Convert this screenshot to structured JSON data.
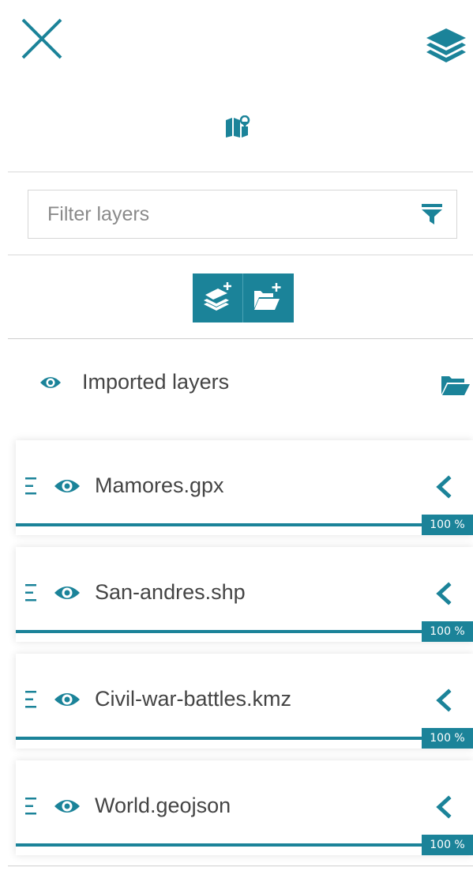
{
  "header": {
    "close_icon": "close-icon",
    "layers_icon": "layers-stack-icon",
    "map_icon": "map-marker-icon"
  },
  "filter": {
    "placeholder": "Filter layers",
    "value": "",
    "icon": "funnel-icon"
  },
  "actions": {
    "add_layer_icon": "add-layer-icon",
    "add_folder_icon": "add-folder-icon"
  },
  "group": {
    "title": "Imported layers",
    "visible": true,
    "icon": "folder-open-icon"
  },
  "layers": [
    {
      "name": "Mamores.gpx",
      "opacity": 1.0,
      "opacity_label": "100 %",
      "visible": true
    },
    {
      "name": "San-andres.shp",
      "opacity": 1.0,
      "opacity_label": "100 %",
      "visible": true
    },
    {
      "name": "Civil-war-battles.kmz",
      "opacity": 1.0,
      "opacity_label": "100 %",
      "visible": true
    },
    {
      "name": "World.geojson",
      "opacity": 1.0,
      "opacity_label": "100 %",
      "visible": true
    }
  ],
  "colors": {
    "accent": "#1b8399",
    "divider": "#d9d9d9",
    "text": "#444444"
  }
}
